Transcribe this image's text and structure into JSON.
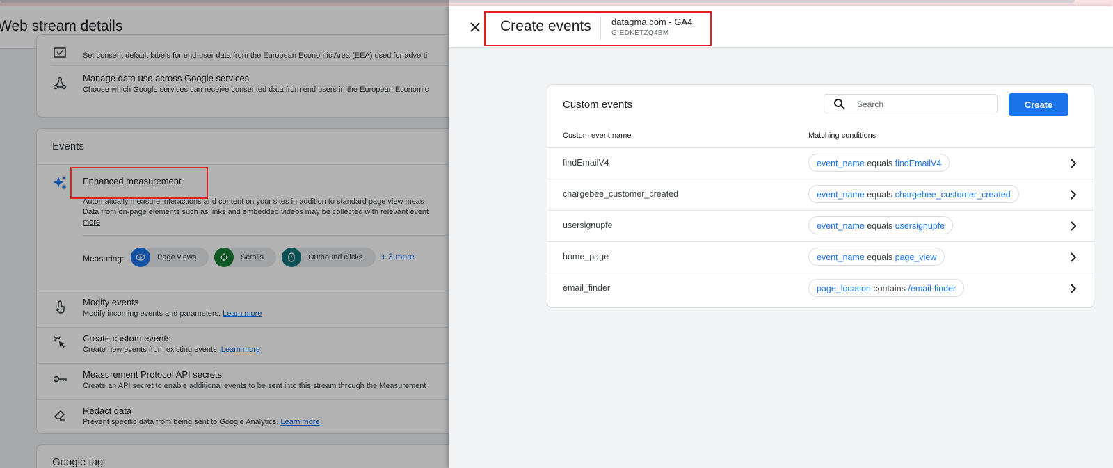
{
  "background_page": {
    "title": "Web stream details",
    "consent": {
      "desc": "Set consent default labels for end-user data from the European Economic Area (EEA) used for adverti"
    },
    "data_use": {
      "title": "Manage data use across Google services",
      "desc": "Choose which Google services can receive consented data from end users in the European Economic"
    },
    "events_section": "Events",
    "enhanced": {
      "title": "Enhanced measurement",
      "desc1": "Automatically measure interactions and content on your sites in addition to standard page view meas",
      "desc2": "Data from on-page elements such as links and embedded videos may be collected with relevant event",
      "more_link": "more",
      "measuring_label": "Measuring:",
      "chips": [
        "Page views",
        "Scrolls",
        "Outbound clicks"
      ],
      "more_count": "+ 3 more"
    },
    "modify": {
      "title": "Modify events",
      "desc": "Modify incoming events and parameters.",
      "link": "Learn more"
    },
    "custom": {
      "title": "Create custom events",
      "desc": "Create new events from existing events.",
      "link": "Learn more"
    },
    "mp": {
      "title": "Measurement Protocol API secrets",
      "desc": "Create an API secret to enable additional events to be sent into this stream through the Measurement"
    },
    "redact": {
      "title": "Redact data",
      "desc": "Prevent specific data from being sent to Google Analytics.",
      "link": "Learn more"
    },
    "google_tag": "Google tag"
  },
  "drawer": {
    "title": "Create events",
    "property_name": "datagma.com - GA4",
    "property_id": "G-EDKETZQ4BM"
  },
  "custom_events": {
    "title": "Custom events",
    "search_placeholder": "Search",
    "create_label": "Create",
    "col_name": "Custom event name",
    "col_conditions": "Matching conditions",
    "rows": [
      {
        "name": "findEmailV4",
        "param": "event_name",
        "op": "equals",
        "value": "findEmailV4"
      },
      {
        "name": "chargebee_customer_created",
        "param": "event_name",
        "op": "equals",
        "value": "chargebee_customer_created"
      },
      {
        "name": "usersignupfe",
        "param": "event_name",
        "op": "equals",
        "value": "usersignupfe"
      },
      {
        "name": "home_page",
        "param": "event_name",
        "op": "equals",
        "value": "page_view"
      },
      {
        "name": "email_finder",
        "param": "page_location",
        "op": "contains",
        "value": "/email-finder"
      }
    ]
  },
  "colors": {
    "accent": "#1a73e8",
    "highlight": "#e0201c",
    "chip_blue": "#1a73e8",
    "chip_green": "#188038",
    "chip_teal": "#12737b"
  }
}
